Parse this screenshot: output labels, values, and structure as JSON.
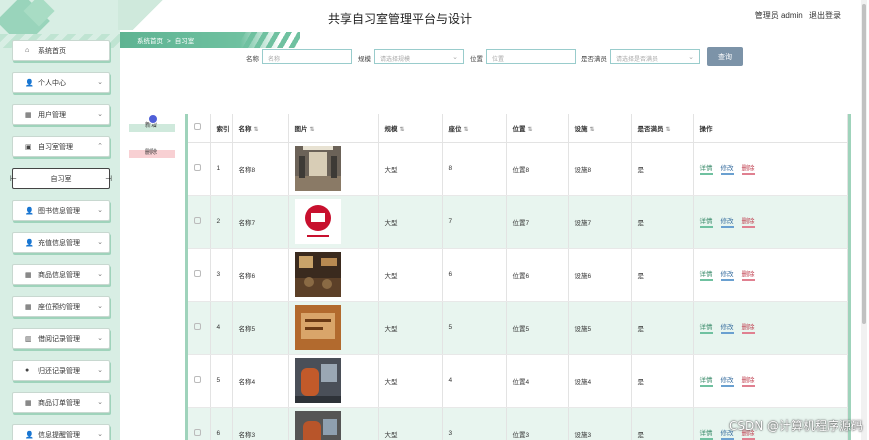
{
  "header": {
    "title": "共享自习室管理平台与设计",
    "user": "管理员 admin",
    "logout": "退出登录"
  },
  "breadcrumb": {
    "home": "系统首页",
    "sep": ">",
    "current": "自习室"
  },
  "sidebar": {
    "items": [
      {
        "label": "系统首页",
        "icon": "home-icon",
        "glyph": "⌂",
        "chev": false
      },
      {
        "label": "个人中心",
        "icon": "user-icon",
        "glyph": "👤",
        "chev": true
      },
      {
        "label": "用户管理",
        "icon": "grid-icon",
        "glyph": "▦",
        "chev": true
      },
      {
        "label": "自习室管理",
        "icon": "book-icon",
        "glyph": "▣",
        "chev": true,
        "up": true
      },
      {
        "label": "自习室",
        "sub": true
      },
      {
        "label": "图书信息管理",
        "icon": "user-icon",
        "glyph": "👤",
        "chev": true
      },
      {
        "label": "充值信息管理",
        "icon": "user-icon",
        "glyph": "👤",
        "chev": true
      },
      {
        "label": "商品信息管理",
        "icon": "grid-icon",
        "glyph": "▦",
        "chev": true
      },
      {
        "label": "座位预约管理",
        "icon": "grid-icon",
        "glyph": "▦",
        "chev": true
      },
      {
        "label": "借阅记录管理",
        "icon": "chart-icon",
        "glyph": "▥",
        "chev": true
      },
      {
        "label": "归还记录管理",
        "icon": "pin-icon",
        "glyph": "●",
        "chev": true
      },
      {
        "label": "商品订单管理",
        "icon": "grid-icon",
        "glyph": "▦",
        "chev": true
      },
      {
        "label": "信息提醒管理",
        "icon": "user-icon",
        "glyph": "👤",
        "chev": true
      }
    ]
  },
  "search": {
    "name_label": "名称",
    "name_placeholder": "名称",
    "size_label": "规模",
    "size_placeholder": "请选择规模",
    "location_label": "位置",
    "location_placeholder": "位置",
    "full_label": "是否满员",
    "full_placeholder": "请选择是否满员",
    "button": "查询"
  },
  "actions": {
    "add": "新增",
    "delete": "删除"
  },
  "table": {
    "headers": [
      "索引",
      "名称",
      "图片",
      "规模",
      "座位",
      "位置",
      "设施",
      "是否满员",
      "操作"
    ],
    "rows": [
      {
        "idx": "1",
        "name": "名称8",
        "size": "大型",
        "seats": "8",
        "loc": "位置8",
        "fac": "设施8",
        "full": "是",
        "img": "corridor"
      },
      {
        "idx": "2",
        "name": "名称7",
        "size": "大型",
        "seats": "7",
        "loc": "位置7",
        "fac": "设施7",
        "full": "是",
        "img": "logo"
      },
      {
        "idx": "3",
        "name": "名称6",
        "size": "大型",
        "seats": "6",
        "loc": "位置6",
        "fac": "设施6",
        "full": "是",
        "img": "cafe"
      },
      {
        "idx": "4",
        "name": "名称5",
        "size": "大型",
        "seats": "5",
        "loc": "位置5",
        "fac": "设施5",
        "full": "是",
        "img": "sign"
      },
      {
        "idx": "5",
        "name": "名称4",
        "size": "大型",
        "seats": "4",
        "loc": "位置4",
        "fac": "设施4",
        "full": "是",
        "img": "room"
      },
      {
        "idx": "6",
        "name": "名称3",
        "size": "大型",
        "seats": "3",
        "loc": "位置3",
        "fac": "设施3",
        "full": "是",
        "img": "room2"
      }
    ],
    "op_detail": "详情",
    "op_edit": "修改",
    "op_delete": "删除"
  },
  "watermark": "CSDN @计算机程序源码"
}
